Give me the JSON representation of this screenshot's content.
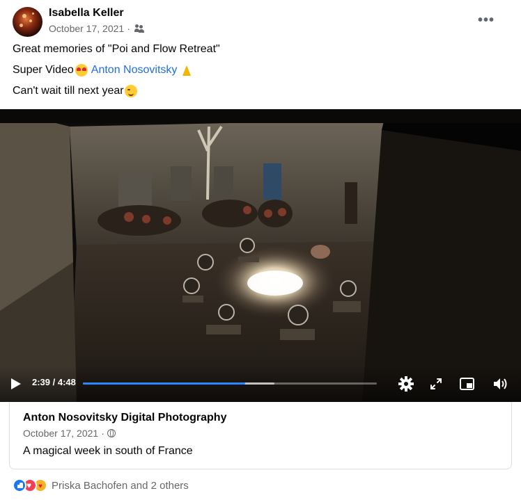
{
  "header": {
    "author_name": "Isabella Keller",
    "date": "October 17, 2021",
    "separator": "·",
    "audience_icon": "friends-icon",
    "more_label": "•••"
  },
  "post_text": {
    "line1": "Great memories of \"Poi and Flow Retreat\"",
    "line2_prefix": "Super Video",
    "line2_emoji": "smiling-face-with-heart-eyes",
    "mention": "Anton Nosovitsky",
    "line2_end_emoji": "folded-hands",
    "line3": "Can't wait till next year",
    "line3_emoji": "winking-face"
  },
  "video": {
    "current_time": "2:39",
    "time_separator": " / ",
    "duration": "4:48",
    "progress_played_fraction": 0.552,
    "progress_buffered_fraction": 0.651,
    "icons": [
      "play-icon",
      "settings-gear-icon",
      "fullscreen-icon",
      "picture-in-picture-icon",
      "volume-icon"
    ]
  },
  "link_preview": {
    "title": "Anton Nosovitsky Digital Photography",
    "date": "October 17, 2021",
    "separator": "·",
    "audience_icon": "globe-icon",
    "description": "A magical week in south of France"
  },
  "reactions": {
    "icons": [
      "like-icon",
      "love-icon",
      "care-icon"
    ],
    "summary": "Priska Bachofen and 2 others"
  },
  "colors": {
    "accent_blue": "#216fdb",
    "progress_blue": "#2d88ff",
    "secondary_text": "#65676b"
  }
}
